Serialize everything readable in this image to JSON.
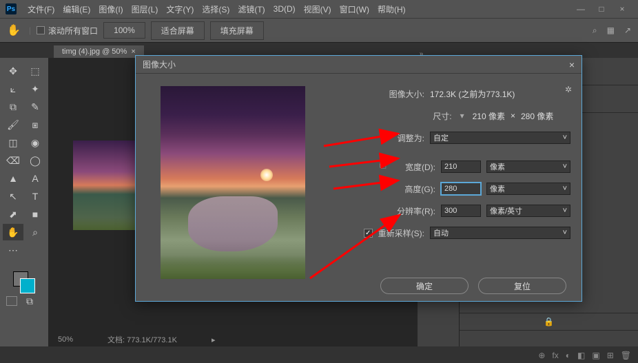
{
  "app": {
    "logo": "Ps"
  },
  "menubar": {
    "items": [
      "文件(F)",
      "编辑(E)",
      "图像(I)",
      "图层(L)",
      "文字(Y)",
      "选择(S)",
      "滤镜(T)",
      "3D(D)",
      "视图(V)",
      "窗口(W)",
      "帮助(H)"
    ]
  },
  "options": {
    "scroll_all": "滚动所有窗口",
    "zoom": "100%",
    "fit_screen": "适合屏幕",
    "fill_screen": "填充屏幕"
  },
  "tab": {
    "label": "timg (4).jpg @ 50%",
    "close": "×",
    "expand": "»"
  },
  "status": {
    "zoom": "50%",
    "docinfo": "文档: 773.1K/773.1K"
  },
  "dialog": {
    "title": "图像大小",
    "close": "×",
    "size_label": "图像大小:",
    "size_value": "172.3K (之前为773.1K)",
    "dim_label": "尺寸:",
    "dim_value_w": "210 像素",
    "dim_sep": "×",
    "dim_value_h": "280 像素",
    "adjust_label": "调整为:",
    "adjust_value": "自定",
    "width_label": "宽度(D):",
    "width_value": "210",
    "width_unit": "像素",
    "height_label": "高度(G):",
    "height_value": "280",
    "height_unit": "像素",
    "res_label": "分辨率(R):",
    "res_value": "300",
    "res_unit": "像素/英寸",
    "resample_label": "重新采样(S):",
    "resample_value": "自动",
    "ok": "确定",
    "reset": "复位",
    "chev": "▾"
  },
  "icons": {
    "lock": "🔒",
    "gear": "✲"
  },
  "footer_icons": [
    "⊕",
    "fx",
    "◐",
    "◧",
    "▣",
    "⊞",
    "🗑"
  ]
}
